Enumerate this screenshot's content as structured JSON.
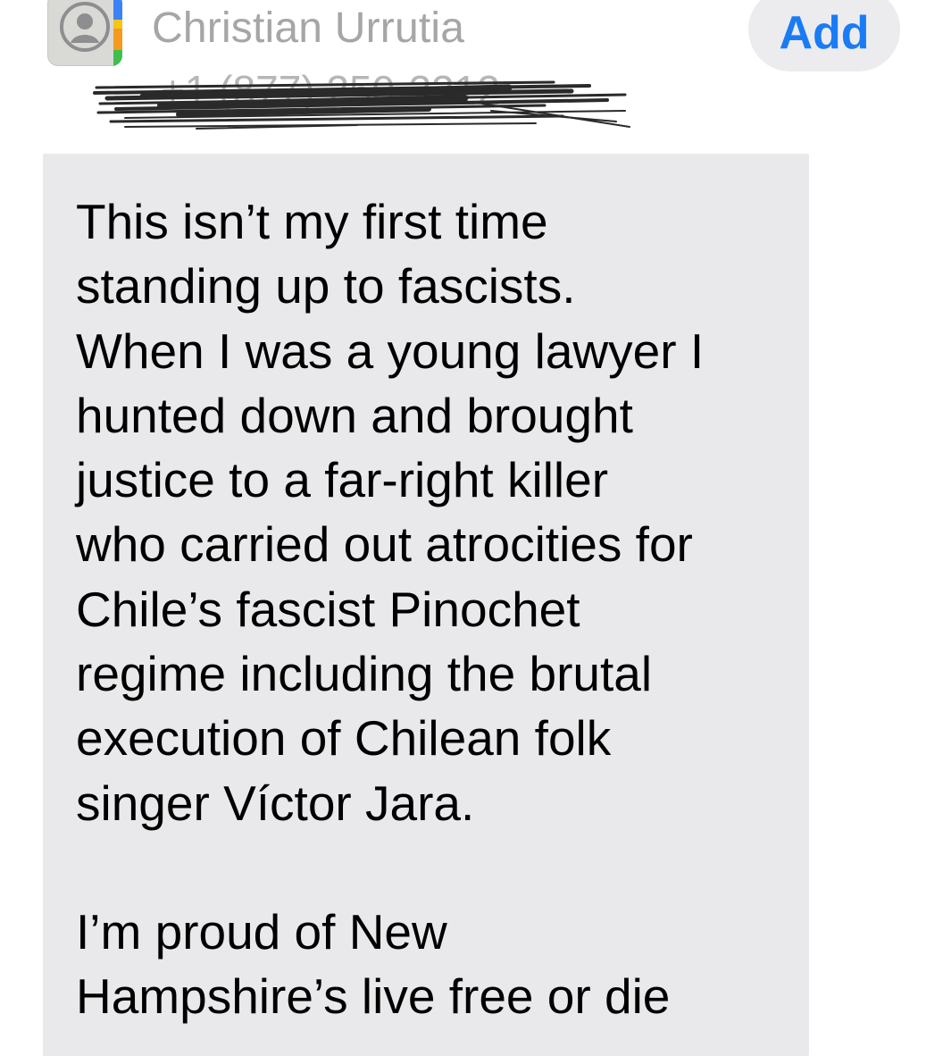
{
  "contact": {
    "name": "Christian Urrutia",
    "phone_redacted": "+1 (877) 250-2212",
    "avatar_icon": "person-placeholder-icon"
  },
  "actions": {
    "add_label": "Add"
  },
  "message": {
    "paragraph_1": "This isn’t my first time\nstanding up to fascists.\nWhen I was a young lawyer I\nhunted down and brought\njustice to a far-right killer\nwho carried out atrocities for\nChile’s fascist Pinochet\nregime including the brutal\nexecution of Chilean folk\nsinger Víctor Jara.",
    "paragraph_2": "I’m proud of New\nHampshire’s live free or die"
  },
  "colors": {
    "accent": "#1a7cf5",
    "bubble": "#e9e9eb",
    "name_text": "#a6a6a8"
  }
}
